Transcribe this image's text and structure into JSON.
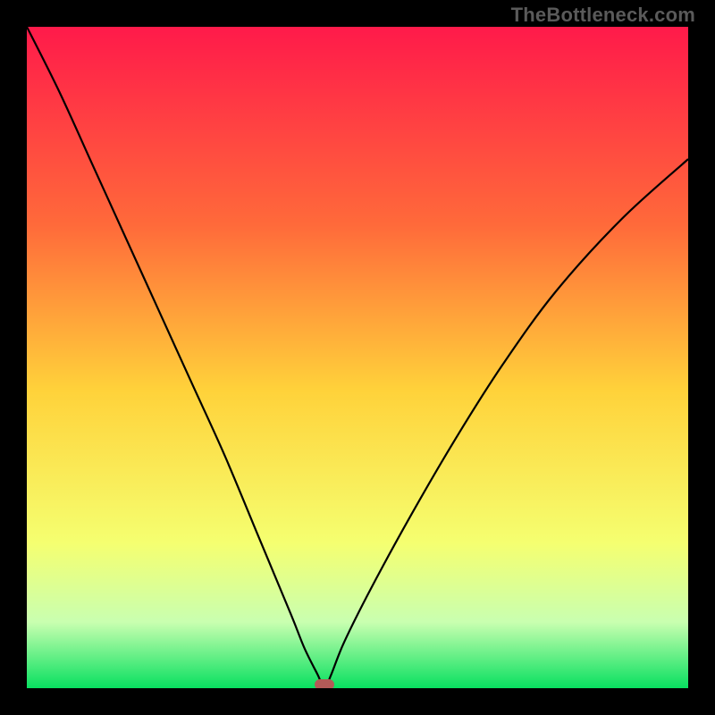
{
  "watermark": "TheBottleneck.com",
  "colors": {
    "frame": "#000000",
    "curve_stroke": "#000000",
    "marker_fill": "#b35a57",
    "gradient_stops": [
      {
        "pct": 0,
        "color": "#ff1a4a"
      },
      {
        "pct": 30,
        "color": "#ff6a3a"
      },
      {
        "pct": 55,
        "color": "#ffd23a"
      },
      {
        "pct": 78,
        "color": "#f5ff70"
      },
      {
        "pct": 90,
        "color": "#c9ffb0"
      },
      {
        "pct": 100,
        "color": "#08e060"
      }
    ]
  },
  "chart_data": {
    "type": "line",
    "title": "",
    "xlabel": "",
    "ylabel": "",
    "xlim": [
      0,
      100
    ],
    "ylim": [
      0,
      100
    ],
    "grid": false,
    "legend": false,
    "note": "V-shaped bottleneck curve; y=0 at the marker, rising toward both x extremes. Axis ticks/labels are not shown, so values are estimated on a 0–100 normalized scale.",
    "series": [
      {
        "name": "bottleneck_curve",
        "x": [
          0,
          5,
          10,
          15,
          20,
          25,
          30,
          35,
          40,
          42,
          44,
          45,
          46,
          48,
          52,
          58,
          65,
          72,
          80,
          90,
          100
        ],
        "y": [
          100,
          90,
          79,
          68,
          57,
          46,
          35,
          23,
          11,
          6,
          2,
          0,
          2,
          7,
          15,
          26,
          38,
          49,
          60,
          71,
          80
        ]
      }
    ],
    "marker": {
      "x": 45,
      "y": 0
    }
  }
}
